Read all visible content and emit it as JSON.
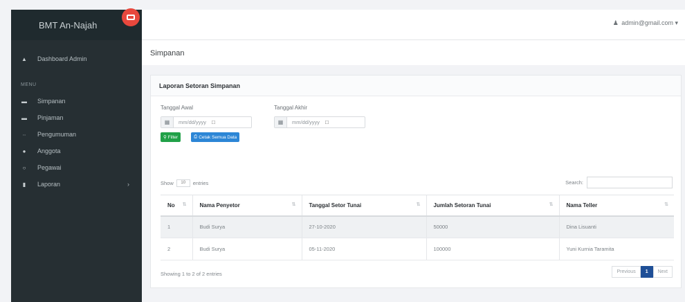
{
  "sidebar": {
    "brand": "BMT An-Najah",
    "menu_label": "MENU",
    "dashboard": {
      "label": "Dashboard Admin",
      "icon": "home-icon"
    },
    "items": [
      {
        "label": "Simpanan",
        "icon": "list-icon"
      },
      {
        "label": "Pinjaman",
        "icon": "list-icon"
      },
      {
        "label": "Pengumuman",
        "icon": "megaphone-icon"
      },
      {
        "label": "Anggota",
        "icon": "users-icon"
      },
      {
        "label": "Pegawai",
        "icon": "user-icon"
      },
      {
        "label": "Laporan",
        "icon": "chart-icon"
      }
    ]
  },
  "topbar": {
    "user": "admin@gmail.com"
  },
  "page": {
    "title": "Simpanan"
  },
  "card": {
    "title": "Laporan Setoran Simpanan",
    "start_label": "Tanggal Awal",
    "end_label": "Tanggal Akhir",
    "start_value": "mm/dd/yyyy",
    "end_value": "mm/dd/yyyy",
    "filter_btn": "Filter",
    "print_btn": "Cetak Semua Data",
    "show": "Show",
    "entries_value": "10",
    "entries": "entries",
    "search_label": "Search:"
  },
  "table": {
    "headers": [
      "No",
      "Nama Penyetor",
      "Tanggal Setor Tunai",
      "Jumlah Setoran Tunai",
      "Nama Teller"
    ],
    "rows": [
      [
        "1",
        "Budi Surya",
        "27-10-2020",
        "50000",
        "Dina Lisuanti"
      ],
      [
        "2",
        "Budi Surya",
        "05-11-2020",
        "100000",
        "Yuni Kurnia Taramita"
      ]
    ]
  },
  "footer": {
    "info": "Showing 1 to 2 of 2 entries",
    "previous": "Previous",
    "page": "1",
    "next": "Next"
  },
  "colors": {
    "sidebar_bg": "#262f33",
    "toggle_red": "#e8483d",
    "filter_green": "#21a148",
    "print_blue": "#2c86d6",
    "active_page": "#1f4f97"
  }
}
